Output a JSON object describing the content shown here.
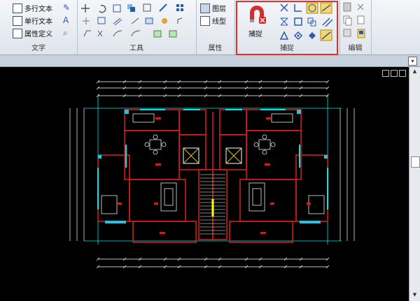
{
  "ribbon": {
    "text_group": {
      "label": "文字",
      "buttons": [
        "多行文本",
        "单行文本",
        "属性定义"
      ]
    },
    "tools_group": {
      "label": "工具"
    },
    "props_group": {
      "label": "属性",
      "buttons": [
        "图层",
        "线型"
      ]
    },
    "snap_group": {
      "label": "捕捉",
      "snap_button": "捕捉",
      "highlight_color": "#e03030"
    },
    "edit_group": {
      "label": "编辑"
    }
  },
  "colors": {
    "wall": "#d01c1c",
    "dim": "#ffffff",
    "grid": "#00e8e8",
    "furniture": "#e8e8e8",
    "stair": "#ffff00",
    "accent": "#2cc0e0"
  }
}
